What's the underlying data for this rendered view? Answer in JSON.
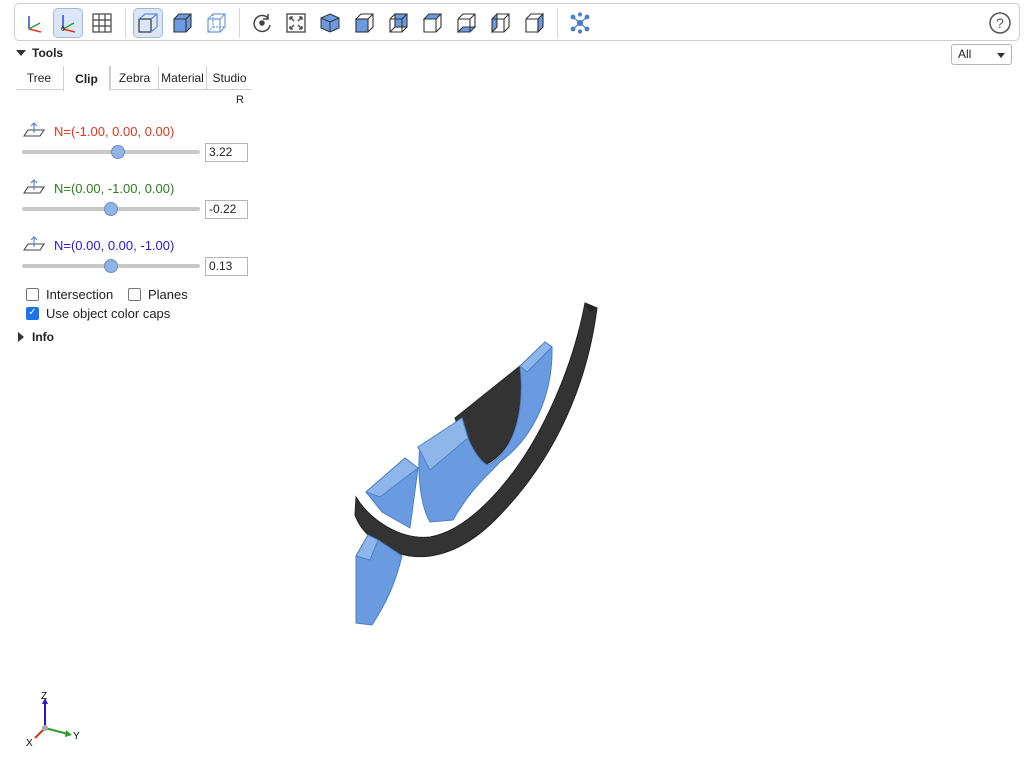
{
  "toolbar": {
    "buttons": [
      {
        "name": "axes-icon"
      },
      {
        "name": "axes-origin-icon"
      },
      {
        "name": "grid-icon"
      },
      {
        "name": "perspective-icon"
      },
      {
        "name": "solid-cube-icon"
      },
      {
        "name": "wireframe-cube-icon"
      },
      {
        "name": "reset-view-icon"
      },
      {
        "name": "fit-view-icon"
      },
      {
        "name": "iso-view-icon"
      },
      {
        "name": "front-view-icon"
      },
      {
        "name": "rear-view-icon"
      },
      {
        "name": "top-view-icon"
      },
      {
        "name": "bottom-view-icon"
      },
      {
        "name": "left-view-icon"
      },
      {
        "name": "right-view-icon"
      },
      {
        "name": "explode-icon"
      },
      {
        "name": "help-icon"
      }
    ],
    "accent": "#5b8fd6"
  },
  "tools": {
    "label": "Tools"
  },
  "tabs": [
    {
      "label": "Tree"
    },
    {
      "label": "Clip"
    },
    {
      "label": "Zebra"
    },
    {
      "label": "Material"
    },
    {
      "label": "Studio"
    }
  ],
  "active_tab": "Clip",
  "reset_label": "R",
  "planes": [
    {
      "normal": "N=(-1.00, 0.00, 0.00)",
      "value": "3.22",
      "color": "#d9381e",
      "slider_fraction": 0.54
    },
    {
      "normal": "N=(0.00, -1.00, 0.00)",
      "value": "-0.22",
      "color": "#2e7d1e",
      "slider_fraction": 0.5
    },
    {
      "normal": "N=(0.00, 0.00, -1.00)",
      "value": "0.13",
      "color": "#2c14d6",
      "slider_fraction": 0.5
    }
  ],
  "options": {
    "intersection": {
      "label": "Intersection",
      "checked": false
    },
    "planes": {
      "label": "Planes",
      "checked": false
    },
    "color_caps": {
      "label": "Use object color caps",
      "checked": true
    }
  },
  "info": {
    "label": "Info"
  },
  "view_select": {
    "value": "All"
  },
  "axis_labels": {
    "x": "X",
    "y": "Y",
    "z": "Z"
  },
  "colors": {
    "part_blue": "#6a9be0",
    "part_dark": "#333333"
  }
}
